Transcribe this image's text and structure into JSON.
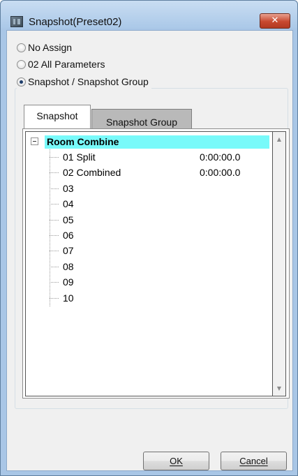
{
  "window": {
    "title": "Snapshot(Preset02)",
    "close_symbol": "✕"
  },
  "options": [
    {
      "label": "No Assign",
      "checked": false
    },
    {
      "label": "02 All Parameters",
      "checked": false
    },
    {
      "label": "Snapshot / Snapshot Group",
      "checked": true
    }
  ],
  "tabs": [
    {
      "label": "Snapshot",
      "active": true
    },
    {
      "label": "Snapshot Group",
      "active": false
    }
  ],
  "tree": {
    "root_label": "Room Combine",
    "root_highlight": "#78fafa",
    "items": [
      {
        "label": "01 Split",
        "time": "0:00:00.0"
      },
      {
        "label": "02 Combined",
        "time": "0:00:00.0"
      },
      {
        "label": "03",
        "time": ""
      },
      {
        "label": "04",
        "time": ""
      },
      {
        "label": "05",
        "time": ""
      },
      {
        "label": "06",
        "time": ""
      },
      {
        "label": "07",
        "time": ""
      },
      {
        "label": "08",
        "time": ""
      },
      {
        "label": "09",
        "time": ""
      },
      {
        "label": "10",
        "time": ""
      }
    ]
  },
  "buttons": {
    "ok_label": "OK",
    "cancel_label": "Cancel"
  },
  "icons": {
    "app": "app-icon",
    "close": "close-icon",
    "expand": "collapse-icon",
    "scroll_up": "scroll-up-arrow-icon",
    "scroll_down": "scroll-down-arrow-icon"
  },
  "colors": {
    "title_bar": "#aac8e8",
    "close_button": "#c7482f",
    "selection": "#78fafa"
  }
}
